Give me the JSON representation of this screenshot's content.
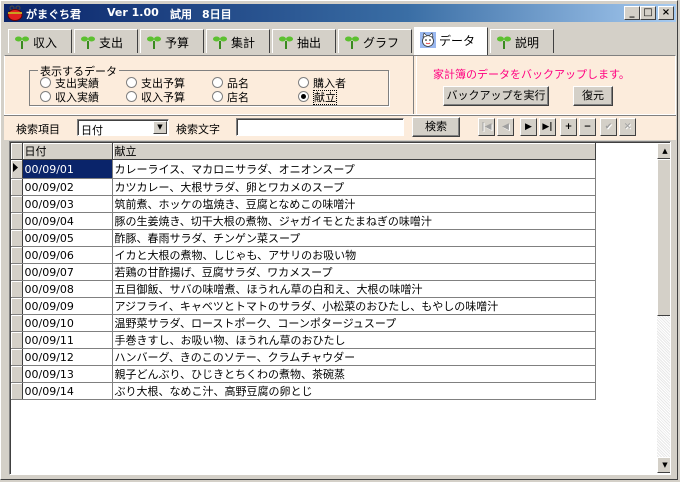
{
  "window": {
    "app_name": "がまぐち君",
    "version": "Ver 1.00",
    "trial": "試用",
    "days_left": "8日目",
    "minimize_glyph": "_",
    "maximize_glyph": "□",
    "close_glyph": "×"
  },
  "tabs": [
    {
      "label": "収入",
      "icon": "sprout-icon",
      "active": false
    },
    {
      "label": "支出",
      "icon": "sprout-icon",
      "active": false
    },
    {
      "label": "予算",
      "icon": "sprout-icon",
      "active": false
    },
    {
      "label": "集計",
      "icon": "sprout-icon",
      "active": false
    },
    {
      "label": "抽出",
      "icon": "sprout-icon",
      "active": false
    },
    {
      "label": "グラフ",
      "icon": "sprout-icon",
      "active": false
    },
    {
      "label": "データ",
      "icon": "lucky-cat-icon",
      "active": true
    },
    {
      "label": "説明",
      "icon": "sprout-icon",
      "active": false
    }
  ],
  "display_data": {
    "legend": "表示するデータ",
    "options": [
      {
        "label": "支出実績",
        "checked": false
      },
      {
        "label": "支出予算",
        "checked": false
      },
      {
        "label": "品名",
        "checked": false
      },
      {
        "label": "購入者",
        "checked": false
      },
      {
        "label": "収入実績",
        "checked": false
      },
      {
        "label": "収入予算",
        "checked": false
      },
      {
        "label": "店名",
        "checked": false
      },
      {
        "label": "献立",
        "checked": true
      }
    ]
  },
  "backup": {
    "message": "家計簿のデータをバックアップします。",
    "run_label": "バックアップを実行",
    "restore_label": "復元"
  },
  "search": {
    "item_label": "検索項目",
    "item_value": "日付",
    "text_label": "検索文字",
    "text_value": "",
    "button_label": "検索",
    "nav_glyphs": {
      "first": "|◀",
      "prev": "◀",
      "next": "▶",
      "last": "▶|",
      "add": "+",
      "delete": "−",
      "post": "✔",
      "cancel": "✕"
    }
  },
  "table": {
    "columns": [
      "日付",
      "献立"
    ],
    "rows": [
      [
        "00/09/01",
        "カレーライス、マカロニサラダ、オニオンスープ"
      ],
      [
        "00/09/02",
        "カツカレー、大根サラダ、卵とワカメのスープ"
      ],
      [
        "00/09/03",
        "筑前煮、ホッケの塩焼き、豆腐となめこの味噌汁"
      ],
      [
        "00/09/04",
        "豚の生姜焼き、切干大根の煮物、ジャガイモとたまねぎの味噌汁"
      ],
      [
        "00/09/05",
        "酢豚、春雨サラダ、チンゲン菜スープ"
      ],
      [
        "00/09/06",
        "イカと大根の煮物、しじゃも、アサリのお吸い物"
      ],
      [
        "00/09/07",
        "若鶏の甘酢揚げ、豆腐サラダ、ワカメスープ"
      ],
      [
        "00/09/08",
        "五目御飯、サバの味噌煮、ほうれん草の白和え、大根の味噌汁"
      ],
      [
        "00/09/09",
        "アジフライ、キャベツとトマトのサラダ、小松菜のおひたし、もやしの味噌汁"
      ],
      [
        "00/09/10",
        "温野菜サラダ、ローストポーク、コーンポタージュスープ"
      ],
      [
        "00/09/11",
        "手巻きすし、お吸い物、ほうれん草のおひたし"
      ],
      [
        "00/09/12",
        "ハンバーグ、きのこのソテー、クラムチャウダー"
      ],
      [
        "00/09/13",
        "親子どんぶり、ひじきとちくわの煮物、茶碗蒸"
      ],
      [
        "00/09/14",
        "ぶり大根、なめこ汁、高野豆腐の卵とじ"
      ]
    ]
  },
  "colors": {
    "title_start": "#0a246a",
    "panel_bg": "#fcecdc",
    "message": "#ff0080",
    "selection": "#0a246a"
  }
}
